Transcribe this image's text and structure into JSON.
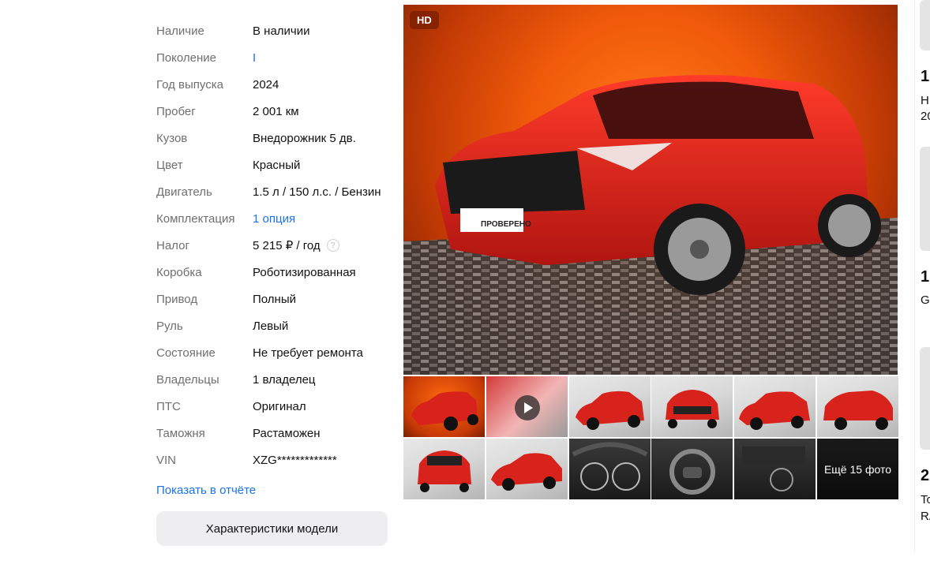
{
  "specs": [
    {
      "label": "Наличие",
      "value": "В наличии"
    },
    {
      "label": "Поколение",
      "value": "I",
      "link": true
    },
    {
      "label": "Год выпуска",
      "value": "2024"
    },
    {
      "label": "Пробег",
      "value": "2 001 км"
    },
    {
      "label": "Кузов",
      "value": "Внедорожник 5 дв."
    },
    {
      "label": "Цвет",
      "value": "Красный"
    },
    {
      "label": "Двигатель",
      "value": "1.5 л / 150 л.с. / Бензин"
    },
    {
      "label": "Комплектация",
      "value": "1 опция",
      "link": true
    },
    {
      "label": "Налог",
      "value": "5 215 ₽ / год",
      "help": "?"
    },
    {
      "label": "Коробка",
      "value": "Роботизированная"
    },
    {
      "label": "Привод",
      "value": "Полный"
    },
    {
      "label": "Руль",
      "value": "Левый"
    },
    {
      "label": "Состояние",
      "value": "Не требует ремонта"
    },
    {
      "label": "Владельцы",
      "value": "1 владелец"
    },
    {
      "label": "ПТС",
      "value": "Оригинал"
    },
    {
      "label": "Таможня",
      "value": "Растаможен"
    },
    {
      "label": "VIN",
      "value": "XZG*************"
    }
  ],
  "show_report_link": "Показать в отчёте",
  "model_specs_button": "Характеристики модели",
  "gallery": {
    "hd_badge": "HD",
    "more_photos": "Ещё 15 фото",
    "plate_text": "ПРОВЕРЕНО",
    "car_color": "#d8231c",
    "background_color": "#f05a0a"
  },
  "right_column": {
    "prices": [
      "1",
      "1",
      "2"
    ],
    "texts": [
      "H",
      "20",
      "G",
      "To",
      "RA"
    ]
  }
}
